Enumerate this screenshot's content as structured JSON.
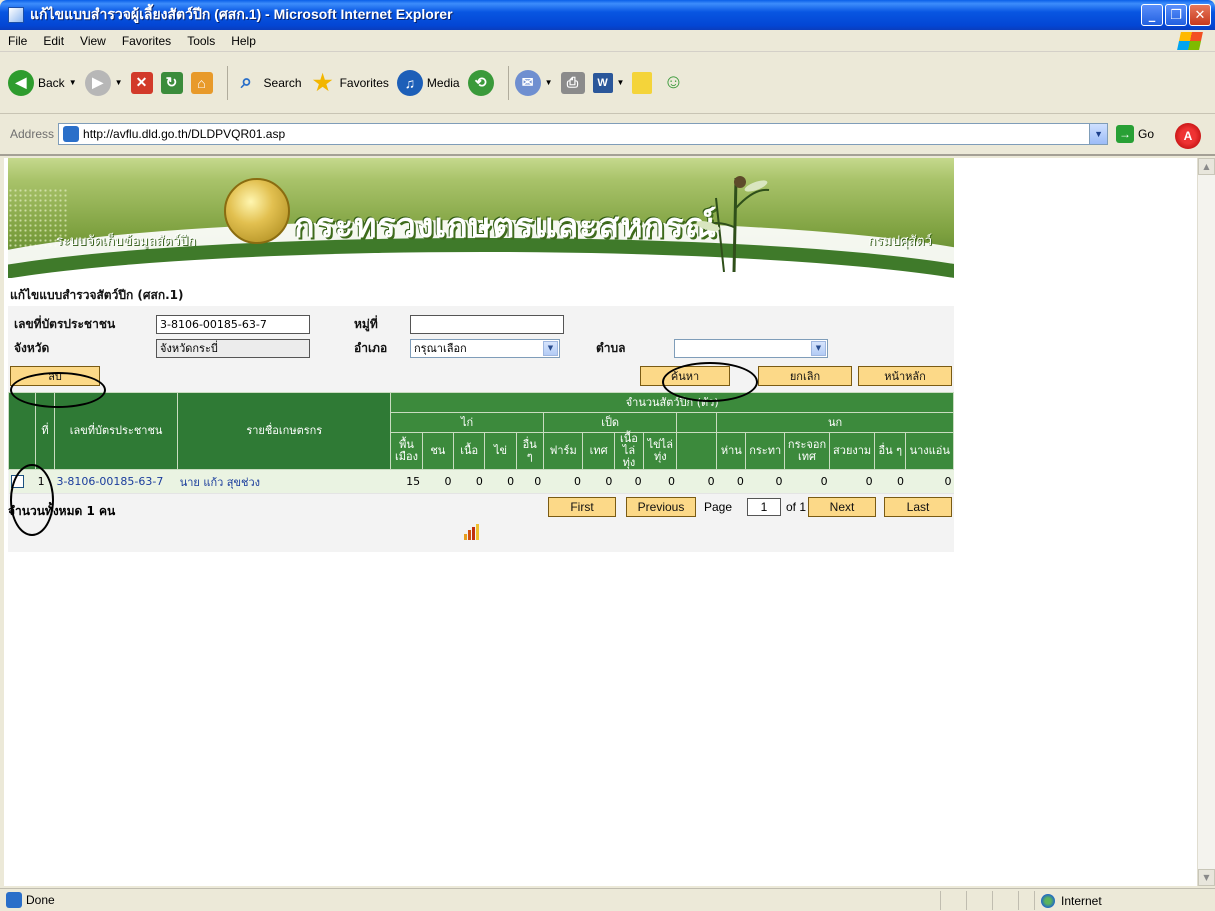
{
  "window": {
    "title": "แก้ไขแบบสำรวจผู้เลี้ยงสัตว์ปีก (ศสก.1) - Microsoft Internet Explorer",
    "minimize": "_",
    "maximize": "❐",
    "close": "✕"
  },
  "menu": [
    "File",
    "Edit",
    "View",
    "Favorites",
    "Tools",
    "Help"
  ],
  "toolbar": {
    "back": "Back",
    "search": "Search",
    "favorites": "Favorites",
    "media": "Media"
  },
  "address": {
    "label": "Address",
    "url": "http://avflu.dld.go.th/DLDPVQR01.asp",
    "go": "Go"
  },
  "banner": {
    "subtitle": "ระบบจัดเก็บข้อมูลสัตว์ปีก",
    "ministry": "กระทรวงเกษตรและสหกรณ์",
    "department": "กรมปศุสัตว์"
  },
  "form": {
    "title": "แก้ไขแบบสำรวจสัตว์ปีก (ศสก.1)",
    "id_label": "เลขที่บัตรประชาชน",
    "id_value": "3-8106-00185-63-7",
    "village_label": "หมู่ที่",
    "village_value": "",
    "province_label": "จังหวัด",
    "province_value": "จังหวัดกระบี่",
    "district_label": "อำเภอ",
    "district_value": "กรุณาเลือก",
    "subdistrict_label": "ตำบล",
    "subdistrict_value": ""
  },
  "buttons": {
    "delete": "ลบ",
    "search": "ค้นหา",
    "cancel": "ยกเลิก",
    "home": "หน้าหลัก"
  },
  "table": {
    "col_no": "ที่",
    "col_id": "เลขที่บัตรประชาชน",
    "col_name": "รายชื่อเกษตรกร",
    "group_total": "จำนวนสัตว์ปีก (ตัว)",
    "group_chicken": "ไก่",
    "group_duck": "เป็ด",
    "group_bird": "นก",
    "sub": [
      "พื้นเมือง",
      "ชน",
      "เนื้อ",
      "ไข่",
      "อื่น ๆ",
      "ฟาร์ม",
      "เทศ",
      "เนื้อไล่ทุ่ง",
      "ไข่ไล่ทุ่ง",
      "",
      "ห่าน",
      "กระทา",
      "กระจอกเทศ",
      "สวยงาม",
      "อื่น ๆ",
      "นางแอ่น"
    ],
    "rows": [
      {
        "no": "1",
        "id": "3-8106-00185-63-7",
        "name": "นาย แก้ว สุขช่วง",
        "values": [
          "15",
          "0",
          "0",
          "0",
          "0",
          "0",
          "0",
          "0",
          "0",
          "0",
          "0",
          "0",
          "0",
          "0",
          "0",
          "0"
        ]
      }
    ]
  },
  "pager": {
    "total": "จำนวนทั้งหมด 1 คน",
    "first": "First",
    "previous": "Previous",
    "page_label": "Page",
    "page_value": "1",
    "of": "of 1",
    "next": "Next",
    "last": "Last"
  },
  "status": {
    "text": "Done",
    "zone": "Internet"
  }
}
